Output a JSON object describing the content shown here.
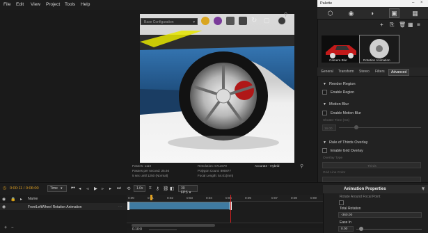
{
  "menu": [
    "File",
    "Edit",
    "View",
    "Project",
    "Tools",
    "Help"
  ],
  "render": {
    "config_label": "Base Configuration",
    "stats": {
      "passes": "Passes: 1110",
      "passes_per_sec": "Passes per second: 25.94",
      "time": "5 sec until 1250 (Normal)",
      "resolution": "Resolution: 671x679",
      "polygons": "Polygon Count: 890877",
      "focal": "Focal Length: 54.01(mm)",
      "mode": "Accurate - Hybrid"
    }
  },
  "palette": {
    "title": "Palette",
    "thumbnails": [
      {
        "label": "Camera Blur"
      },
      {
        "label": "Rotation Animation"
      }
    ],
    "prop_tabs": [
      "General",
      "Transform",
      "Stereo",
      "Filters",
      "Advanced"
    ],
    "active_tab": "Advanced",
    "sections": [
      {
        "title": "Render Region",
        "checkbox": "Enable Region"
      },
      {
        "title": "Motion Blur",
        "checkbox": "Enable Motion Blur",
        "sub_label": "Shutter Time (ms)",
        "sub_value": "16.00"
      },
      {
        "title": "Rule of Thirds Overlay",
        "checkbox": "Enable Grid Overlay",
        "sub_label": "Overlay Type",
        "sub_value": "Thirds",
        "extra_label": "Grid Line Color"
      }
    ]
  },
  "timeline": {
    "time": "0:00:11 / 0:06:00",
    "time_mode": "Time",
    "speed": "1.0x",
    "fps": "30 FPS",
    "name_header": "Name",
    "track_name": "FrontLeftWheel Rotation Animation",
    "ticks": [
      "0:00",
      "0:01",
      "0:02",
      "0:03",
      "0:04",
      "0:05",
      "0:06",
      "0:07",
      "0:08",
      "0:09"
    ],
    "zoom": "0.10:0"
  },
  "anim_props": {
    "title": "Animation Properties",
    "rotate_label": "Rotate Around Focal Point",
    "total_rotation_label": "Total Rotation",
    "total_rotation": "-360.00",
    "ease_in_label": "Ease In",
    "ease_in": "0.00"
  },
  "colors": {
    "accent": "#e0a020",
    "clip": "#3f7aa0",
    "playhead": "#d02020",
    "car_body": "#2f6fa8"
  }
}
